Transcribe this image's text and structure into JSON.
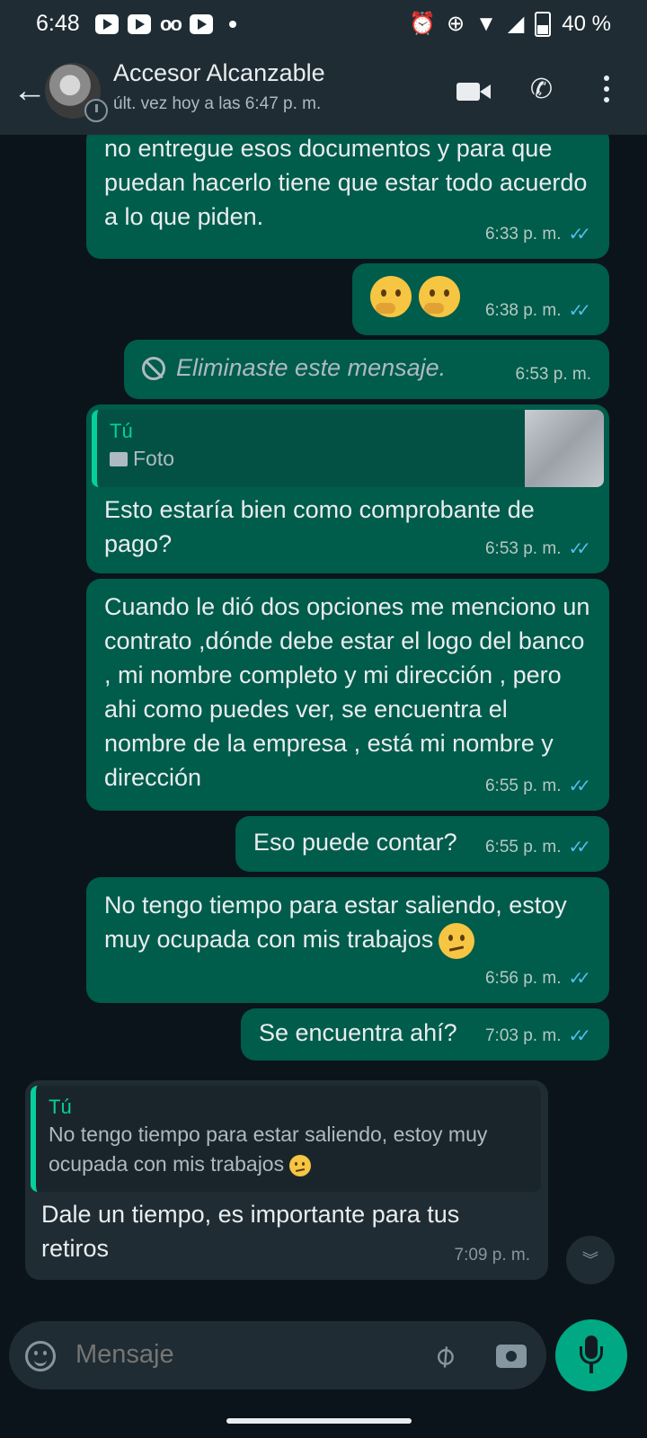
{
  "status_bar": {
    "time": "6:48",
    "battery": "40 %"
  },
  "header": {
    "contact_name": "Accesor Alcanzable",
    "last_seen": "últ. vez hoy a las 6:47 p. m."
  },
  "messages": [
    {
      "type": "out",
      "text": "no entregue esos documentos y para que puedan hacerlo tiene que estar todo acuerdo a lo que piden.",
      "time": "6:33 p. m.",
      "status": "read"
    },
    {
      "type": "out",
      "emoji": [
        "thinking-face",
        "thinking-face"
      ],
      "time": "6:38 p. m.",
      "status": "read"
    },
    {
      "type": "out",
      "deleted": true,
      "text": "Eliminaste este mensaje.",
      "time": "6:53 p. m."
    },
    {
      "type": "out",
      "reply": {
        "author": "Tú",
        "text": "Foto"
      },
      "text": "Esto estaría bien como comprobante de pago?",
      "time": "6:53 p. m.",
      "status": "read"
    },
    {
      "type": "out",
      "text": "Cuando le dió dos opciones me menciono un contrato ,dónde debe estar el logo del banco , mi nombre completo y mi dirección , pero ahi como puedes ver, se encuentra el nombre de la empresa , está mi nombre y dirección",
      "time": "6:55 p. m.",
      "status": "read"
    },
    {
      "type": "out",
      "text": "Eso puede contar?",
      "time": "6:55 p. m.",
      "status": "read"
    },
    {
      "type": "out",
      "text": "No tengo tiempo para estar saliendo, estoy muy ocupada con mis trabajos",
      "time": "6:56 p. m.",
      "status": "read"
    },
    {
      "type": "out",
      "text": "Se encuentra ahí?",
      "time": "7:03 p. m.",
      "status": "read"
    },
    {
      "type": "in",
      "reply": {
        "author": "Tú",
        "text": "No tengo tiempo para estar saliendo, estoy muy ocupada con mis trabajos"
      },
      "text": "Dale un tiempo, es importante para tus retiros",
      "time": "7:09 p. m."
    }
  ],
  "composer": {
    "placeholder": "Mensaje"
  },
  "colors": {
    "outgoing_bubble": "#005c4b",
    "incoming_bubble": "#202c33",
    "accent": "#00a884",
    "read_ticks": "#53bdeb"
  }
}
